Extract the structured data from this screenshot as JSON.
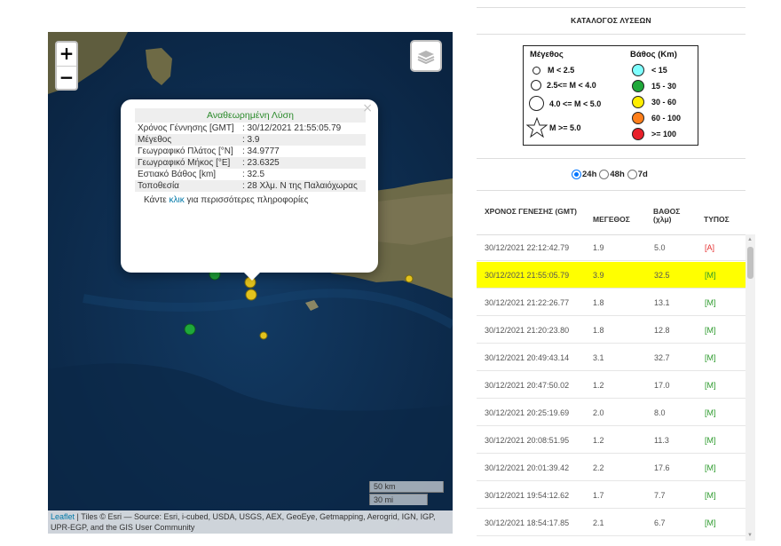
{
  "map": {
    "zoom_in": "+",
    "zoom_out": "−",
    "layers_icon": "layers-icon",
    "popup": {
      "title": "Αναθεωρημένη Λύση",
      "close": "×",
      "rows": [
        {
          "label": "Χρόνος Γέννησης [GMT]",
          "value": ": 30/12/2021 21:55:05.79"
        },
        {
          "label": "Μέγεθος",
          "value": ": 3.9"
        },
        {
          "label": "Γεωγραφικό Πλάτος [°N]",
          "value": ": 34.9777"
        },
        {
          "label": "Γεωγραφικό Μήκος [°E]",
          "value": ": 23.6325"
        },
        {
          "label": "Εστιακό Βάθος [km]",
          "value": ": 32.5"
        },
        {
          "label": "Τοποθεσία",
          "value": ": 28 Χλμ. N της Παλαιόχωρας"
        }
      ],
      "more_prefix": "Κάντε ",
      "more_link": "κλικ",
      "more_suffix": " για περισσότερες πληροφορίες"
    },
    "scale_km": "50 km",
    "scale_mi": "30 mi",
    "attribution_link": "Leaflet",
    "attribution_text": " | Tiles © Esri — Source: Esri, i-cubed, USDA, USGS, AEX, GeoEye, Getmapping, Aerogrid, IGN, IGP, UPR-EGP, and the GIS User Community"
  },
  "panel": {
    "catalog_title": "ΚΑΤΑΛΟΓΟΣ ΛΥΣΕΩΝ",
    "legend": {
      "mag_header": "Μέγεθος",
      "depth_header": "Βάθος (Km)",
      "magnitudes": [
        "M < 2.5",
        "2.5<= M < 4.0",
        "4.0 <= M < 5.0",
        "M >= 5.0"
      ],
      "depths": [
        {
          "label": "< 15",
          "color": "#7fffff"
        },
        {
          "label": "15 - 30",
          "color": "#1fa83a"
        },
        {
          "label": "30 - 60",
          "color": "#ffee00"
        },
        {
          "label": "60 - 100",
          "color": "#ff7f1a"
        },
        {
          "label": ">= 100",
          "color": "#e8202a"
        }
      ]
    },
    "periods": [
      {
        "label": "24h",
        "selected": true
      },
      {
        "label": "48h",
        "selected": false
      },
      {
        "label": "7d",
        "selected": false
      }
    ],
    "table": {
      "headers": [
        "ΧΡΟΝΟΣ ΓΕΝΕΣΗΣ (GMT)",
        "ΜΕΓΕΘΟΣ",
        "ΒΑΘΟΣ (χλμ)",
        "ΤΥΠΟΣ"
      ],
      "rows": [
        {
          "time": "30/12/2021 22:12:42.79",
          "mag": "1.9",
          "depth": "5.0",
          "type": "[A]"
        },
        {
          "time": "30/12/2021 21:55:05.79",
          "mag": "3.9",
          "depth": "32.5",
          "type": "[M]"
        },
        {
          "time": "30/12/2021 21:22:26.77",
          "mag": "1.8",
          "depth": "13.1",
          "type": "[M]"
        },
        {
          "time": "30/12/2021 21:20:23.80",
          "mag": "1.8",
          "depth": "12.8",
          "type": "[M]"
        },
        {
          "time": "30/12/2021 20:49:43.14",
          "mag": "3.1",
          "depth": "32.7",
          "type": "[M]"
        },
        {
          "time": "30/12/2021 20:47:50.02",
          "mag": "1.2",
          "depth": "17.0",
          "type": "[M]"
        },
        {
          "time": "30/12/2021 20:25:19.69",
          "mag": "2.0",
          "depth": "8.0",
          "type": "[M]"
        },
        {
          "time": "30/12/2021 20:08:51.95",
          "mag": "1.2",
          "depth": "11.3",
          "type": "[M]"
        },
        {
          "time": "30/12/2021 20:01:39.42",
          "mag": "2.2",
          "depth": "17.6",
          "type": "[M]"
        },
        {
          "time": "30/12/2021 19:54:12.62",
          "mag": "1.7",
          "depth": "7.7",
          "type": "[M]"
        },
        {
          "time": "30/12/2021 18:54:17.85",
          "mag": "2.1",
          "depth": "6.7",
          "type": "[M]"
        }
      ],
      "selected_index": 1
    }
  }
}
